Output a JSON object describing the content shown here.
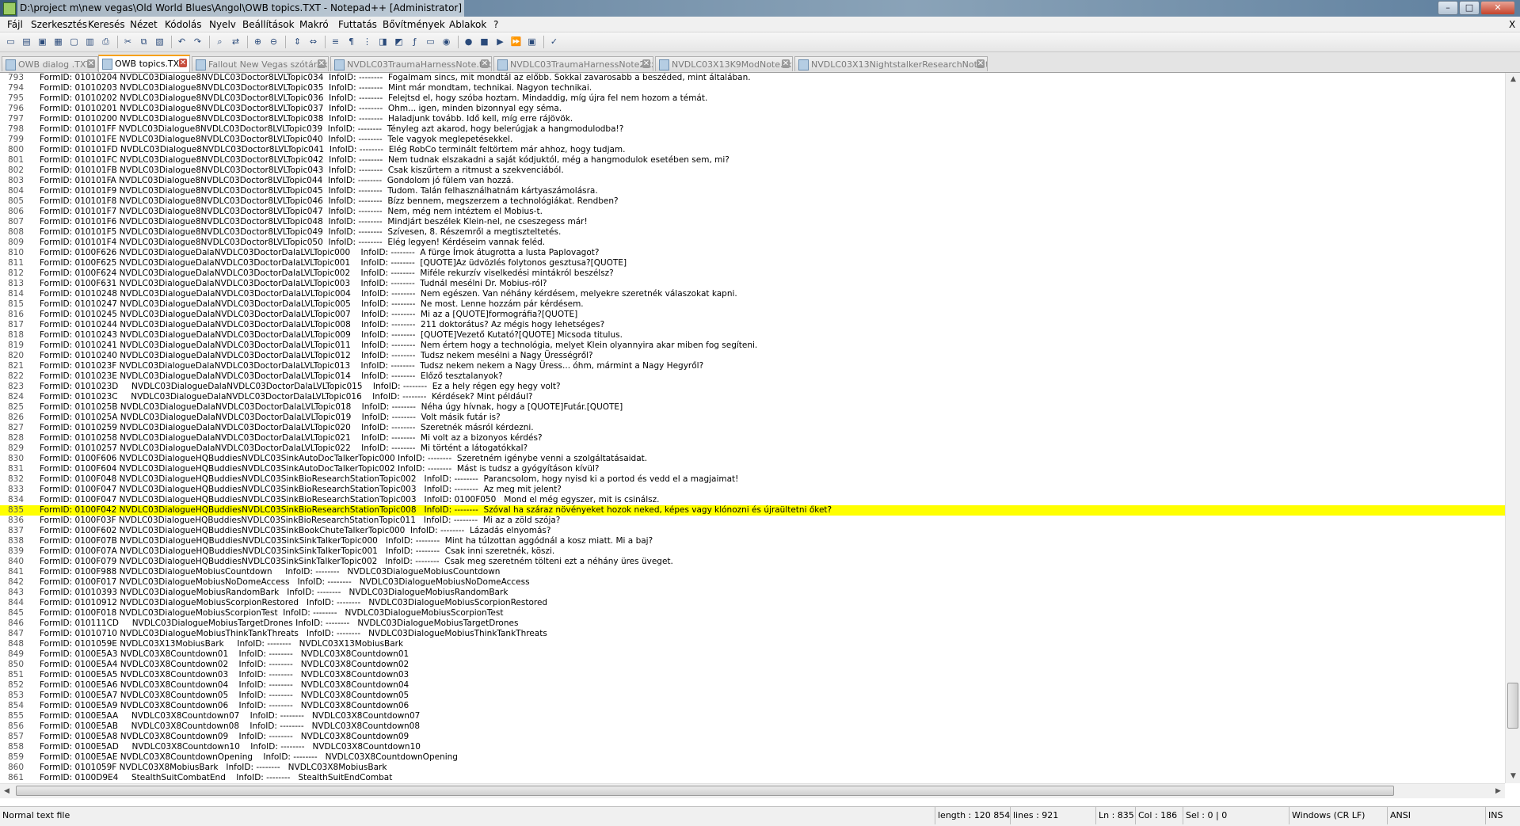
{
  "window": {
    "title": "D:\\project m\\new vegas\\Old World Blues\\Angol\\OWB topics.TXT - Notepad++ [Administrator]",
    "controls": {
      "minimize": "–",
      "maximize": "□",
      "close": "✕"
    }
  },
  "menu": [
    "Fájl",
    "Szerkesztés",
    "Keresés",
    "Nézet",
    "Kódolás",
    "Nyelv",
    "Beállítások",
    "Makró",
    "Futtatás",
    "Bővítmények",
    "Ablakok",
    "?"
  ],
  "menu_right_close": "X",
  "tabs": [
    {
      "label": "OWB dialog .TXT",
      "active": false
    },
    {
      "label": "OWB topics.TXT",
      "active": true
    },
    {
      "label": "Fallout New Vegas szótár.txt",
      "active": false
    },
    {
      "label": "NVDLC03TraumaHarnessNote.txt",
      "active": false
    },
    {
      "label": "NVDLC03TraumaHarnessNote2.txt",
      "active": false
    },
    {
      "label": "NVDLC03X13K9ModNote.txt",
      "active": false
    },
    {
      "label": "NVDLC03X13NightstalkerResearchNote.txt",
      "active": false
    }
  ],
  "editor": {
    "highlight_line": "835",
    "lines": [
      {
        "n": "793",
        "t": "FormID: 01010204 NVDLC03Dialogue8NVDLC03Doctor8LVLTopic034  InfoID: --------  Fogalmam sincs, mit mondtál az előbb. Sokkal zavarosabb a beszéded, mint általában."
      },
      {
        "n": "794",
        "t": "FormID: 01010203 NVDLC03Dialogue8NVDLC03Doctor8LVLTopic035  InfoID: --------  Mint már mondtam, technikai. Nagyon technikai."
      },
      {
        "n": "795",
        "t": "FormID: 01010202 NVDLC03Dialogue8NVDLC03Doctor8LVLTopic036  InfoID: --------  Felejtsd el, hogy szóba hoztam. Mindaddig, míg újra fel nem hozom a témát."
      },
      {
        "n": "796",
        "t": "FormID: 01010201 NVDLC03Dialogue8NVDLC03Doctor8LVLTopic037  InfoID: --------  Ohm... igen, minden bizonnyal egy séma."
      },
      {
        "n": "797",
        "t": "FormID: 01010200 NVDLC03Dialogue8NVDLC03Doctor8LVLTopic038  InfoID: --------  Haladjunk tovább. Idő kell, míg erre rájövök."
      },
      {
        "n": "798",
        "t": "FormID: 010101FF NVDLC03Dialogue8NVDLC03Doctor8LVLTopic039  InfoID: --------  Tényleg azt akarod, hogy belerúgjak a hangmodulodba!?"
      },
      {
        "n": "799",
        "t": "FormID: 010101FE NVDLC03Dialogue8NVDLC03Doctor8LVLTopic040  InfoID: --------  Tele vagyok meglepetésekkel."
      },
      {
        "n": "800",
        "t": "FormID: 010101FD NVDLC03Dialogue8NVDLC03Doctor8LVLTopic041  InfoID: --------  Elég RobCo terminált feltörtem már ahhoz, hogy tudjam."
      },
      {
        "n": "801",
        "t": "FormID: 010101FC NVDLC03Dialogue8NVDLC03Doctor8LVLTopic042  InfoID: --------  Nem tudnak elszakadni a saját kódjuktól, még a hangmodulok esetében sem, mi?"
      },
      {
        "n": "802",
        "t": "FormID: 010101FB NVDLC03Dialogue8NVDLC03Doctor8LVLTopic043  InfoID: --------  Csak kiszűrtem a ritmust a szekvenciából."
      },
      {
        "n": "803",
        "t": "FormID: 010101FA NVDLC03Dialogue8NVDLC03Doctor8LVLTopic044  InfoID: --------  Gondolom jó fülem van hozzá."
      },
      {
        "n": "804",
        "t": "FormID: 010101F9 NVDLC03Dialogue8NVDLC03Doctor8LVLTopic045  InfoID: --------  Tudom. Talán felhasználhatnám kártyaszámolásra."
      },
      {
        "n": "805",
        "t": "FormID: 010101F8 NVDLC03Dialogue8NVDLC03Doctor8LVLTopic046  InfoID: --------  Bízz bennem, megszerzem a technológiákat. Rendben?"
      },
      {
        "n": "806",
        "t": "FormID: 010101F7 NVDLC03Dialogue8NVDLC03Doctor8LVLTopic047  InfoID: --------  Nem, még nem intéztem el Mobius-t."
      },
      {
        "n": "807",
        "t": "FormID: 010101F6 NVDLC03Dialogue8NVDLC03Doctor8LVLTopic048  InfoID: --------  Mindjárt beszélek Klein-nel, ne cseszegess már!"
      },
      {
        "n": "808",
        "t": "FormID: 010101F5 NVDLC03Dialogue8NVDLC03Doctor8LVLTopic049  InfoID: --------  Szívesen, 8. Részemről a megtiszteltetés."
      },
      {
        "n": "809",
        "t": "FormID: 010101F4 NVDLC03Dialogue8NVDLC03Doctor8LVLTopic050  InfoID: --------  Elég legyen! Kérdéseim vannak feléd."
      },
      {
        "n": "810",
        "t": "FormID: 0100F626 NVDLC03DialogueDalaNVDLC03DoctorDalaLVLTopic000    InfoID: --------  A fürge Írnok átugrotta a lusta Paplovagot?"
      },
      {
        "n": "811",
        "t": "FormID: 0100F625 NVDLC03DialogueDalaNVDLC03DoctorDalaLVLTopic001    InfoID: --------  [QUOTE]Az üdvözlés folytonos gesztusa?[QUOTE]"
      },
      {
        "n": "812",
        "t": "FormID: 0100F624 NVDLC03DialogueDalaNVDLC03DoctorDalaLVLTopic002    InfoID: --------  Miféle rekurzív viselkedési mintákról beszélsz?"
      },
      {
        "n": "813",
        "t": "FormID: 0100F631 NVDLC03DialogueDalaNVDLC03DoctorDalaLVLTopic003    InfoID: --------  Tudnál mesélni Dr. Mobius-ról?"
      },
      {
        "n": "814",
        "t": "FormID: 01010248 NVDLC03DialogueDalaNVDLC03DoctorDalaLVLTopic004    InfoID: --------  Nem egészen. Van néhány kérdésem, melyekre szeretnék válaszokat kapni."
      },
      {
        "n": "815",
        "t": "FormID: 01010247 NVDLC03DialogueDalaNVDLC03DoctorDalaLVLTopic005    InfoID: --------  Ne most. Lenne hozzám pár kérdésem."
      },
      {
        "n": "816",
        "t": "FormID: 01010245 NVDLC03DialogueDalaNVDLC03DoctorDalaLVLTopic007    InfoID: --------  Mi az a [QUOTE]formográfia?[QUOTE]"
      },
      {
        "n": "817",
        "t": "FormID: 01010244 NVDLC03DialogueDalaNVDLC03DoctorDalaLVLTopic008    InfoID: --------  211 doktorátus? Az mégis hogy lehetséges?"
      },
      {
        "n": "818",
        "t": "FormID: 01010243 NVDLC03DialogueDalaNVDLC03DoctorDalaLVLTopic009    InfoID: --------  [QUOTE]Vezető Kutató?[QUOTE] Micsoda titulus."
      },
      {
        "n": "819",
        "t": "FormID: 01010241 NVDLC03DialogueDalaNVDLC03DoctorDalaLVLTopic011    InfoID: --------  Nem értem hogy a technológia, melyet Klein olyannyira akar miben fog segíteni."
      },
      {
        "n": "820",
        "t": "FormID: 01010240 NVDLC03DialogueDalaNVDLC03DoctorDalaLVLTopic012    InfoID: --------  Tudsz nekem mesélni a Nagy Ürességről?"
      },
      {
        "n": "821",
        "t": "FormID: 0101023F NVDLC03DialogueDalaNVDLC03DoctorDalaLVLTopic013    InfoID: --------  Tudsz nekem nekem a Nagy Üress... óhm, mármint a Nagy Hegyről?"
      },
      {
        "n": "822",
        "t": "FormID: 0101023E NVDLC03DialogueDalaNVDLC03DoctorDalaLVLTopic014    InfoID: --------  Előző tesztalanyok?"
      },
      {
        "n": "823",
        "t": "FormID: 0101023D     NVDLC03DialogueDalaNVDLC03DoctorDalaLVLTopic015    InfoID: --------  Ez a hely régen egy hegy volt?"
      },
      {
        "n": "824",
        "t": "FormID: 0101023C     NVDLC03DialogueDalaNVDLC03DoctorDalaLVLTopic016    InfoID: --------  Kérdések? Mint például?"
      },
      {
        "n": "825",
        "t": "FormID: 0101025B NVDLC03DialogueDalaNVDLC03DoctorDalaLVLTopic018    InfoID: --------  Néha úgy hívnak, hogy a [QUOTE]Futár.[QUOTE]"
      },
      {
        "n": "826",
        "t": "FormID: 0101025A NVDLC03DialogueDalaNVDLC03DoctorDalaLVLTopic019    InfoID: --------  Volt másik futár is?"
      },
      {
        "n": "827",
        "t": "FormID: 01010259 NVDLC03DialogueDalaNVDLC03DoctorDalaLVLTopic020    InfoID: --------  Szeretnék másról kérdezni."
      },
      {
        "n": "828",
        "t": "FormID: 01010258 NVDLC03DialogueDalaNVDLC03DoctorDalaLVLTopic021    InfoID: --------  Mi volt az a bizonyos kérdés?"
      },
      {
        "n": "829",
        "t": "FormID: 01010257 NVDLC03DialogueDalaNVDLC03DoctorDalaLVLTopic022    InfoID: --------  Mi történt a látogatókkal?"
      },
      {
        "n": "830",
        "t": "FormID: 0100F606 NVDLC03DialogueHQBuddiesNVDLC03SinkAutoDocTalkerTopic000 InfoID: --------  Szeretném igénybe venni a szolgáltatásaidat."
      },
      {
        "n": "831",
        "t": "FormID: 0100F604 NVDLC03DialogueHQBuddiesNVDLC03SinkAutoDocTalkerTopic002 InfoID: --------  Mást is tudsz a gyógyításon kívül?"
      },
      {
        "n": "832",
        "t": "FormID: 0100F048 NVDLC03DialogueHQBuddiesNVDLC03SinkBioResearchStationTopic002   InfoID: --------  Parancsolom, hogy nyisd ki a portod és vedd el a magjaimat!"
      },
      {
        "n": "833",
        "t": "FormID: 0100F047 NVDLC03DialogueHQBuddiesNVDLC03SinkBioResearchStationTopic003   InfoID: --------  Az meg mit jelent?"
      },
      {
        "n": "834",
        "t": "FormID: 0100F047 NVDLC03DialogueHQBuddiesNVDLC03SinkBioResearchStationTopic003   InfoID: 0100F050   Mond el még egyszer, mit is csinálsz."
      },
      {
        "n": "835",
        "t": "FormID: 0100F042 NVDLC03DialogueHQBuddiesNVDLC03SinkBioResearchStationTopic008   InfoID: --------  Szóval ha száraz növényeket hozok neked, képes vagy klónozni és újraültetni őket?"
      },
      {
        "n": "836",
        "t": "FormID: 0100F03F NVDLC03DialogueHQBuddiesNVDLC03SinkBioResearchStationTopic011   InfoID: --------  Mi az a zöld szója?"
      },
      {
        "n": "837",
        "t": "FormID: 0100F602 NVDLC03DialogueHQBuddiesNVDLC03SinkBookChuteTalkerTopic000  InfoID: --------  Lázadás elnyomás?"
      },
      {
        "n": "838",
        "t": "FormID: 0100F07B NVDLC03DialogueHQBuddiesNVDLC03SinkSinkTalkerTopic000   InfoID: --------  Mint ha túlzottan aggódnál a kosz miatt. Mi a baj?"
      },
      {
        "n": "839",
        "t": "FormID: 0100F07A NVDLC03DialogueHQBuddiesNVDLC03SinkSinkTalkerTopic001   InfoID: --------  Csak inni szeretnék, köszi."
      },
      {
        "n": "840",
        "t": "FormID: 0100F079 NVDLC03DialogueHQBuddiesNVDLC03SinkSinkTalkerTopic002   InfoID: --------  Csak meg szeretném tölteni ezt a néhány üres üveget."
      },
      {
        "n": "841",
        "t": "FormID: 0100F988 NVDLC03DialogueMobiusCountdown     InfoID: --------   NVDLC03DialogueMobiusCountdown"
      },
      {
        "n": "842",
        "t": "FormID: 0100F017 NVDLC03DialogueMobiusNoDomeAccess   InfoID: --------   NVDLC03DialogueMobiusNoDomeAccess"
      },
      {
        "n": "843",
        "t": "FormID: 01010393 NVDLC03DialogueMobiusRandomBark   InfoID: --------   NVDLC03DialogueMobiusRandomBark"
      },
      {
        "n": "844",
        "t": "FormID: 01010912 NVDLC03DialogueMobiusScorpionRestored   InfoID: --------   NVDLC03DialogueMobiusScorpionRestored"
      },
      {
        "n": "845",
        "t": "FormID: 0100F018 NVDLC03DialogueMobiusScorpionTest  InfoID: --------   NVDLC03DialogueMobiusScorpionTest"
      },
      {
        "n": "846",
        "t": "FormID: 010111CD     NVDLC03DialogueMobiusTargetDrones InfoID: --------   NVDLC03DialogueMobiusTargetDrones"
      },
      {
        "n": "847",
        "t": "FormID: 01010710 NVDLC03DialogueMobiusThinkTankThreats   InfoID: --------   NVDLC03DialogueMobiusThinkTankThreats"
      },
      {
        "n": "848",
        "t": "FormID: 0101059E NVDLC03X13MobiusBark     InfoID: --------   NVDLC03X13MobiusBark"
      },
      {
        "n": "849",
        "t": "FormID: 0100E5A3 NVDLC03X8Countdown01    InfoID: --------   NVDLC03X8Countdown01"
      },
      {
        "n": "850",
        "t": "FormID: 0100E5A4 NVDLC03X8Countdown02    InfoID: --------   NVDLC03X8Countdown02"
      },
      {
        "n": "851",
        "t": "FormID: 0100E5A5 NVDLC03X8Countdown03    InfoID: --------   NVDLC03X8Countdown03"
      },
      {
        "n": "852",
        "t": "FormID: 0100E5A6 NVDLC03X8Countdown04    InfoID: --------   NVDLC03X8Countdown04"
      },
      {
        "n": "853",
        "t": "FormID: 0100E5A7 NVDLC03X8Countdown05    InfoID: --------   NVDLC03X8Countdown05"
      },
      {
        "n": "854",
        "t": "FormID: 0100E5A9 NVDLC03X8Countdown06    InfoID: --------   NVDLC03X8Countdown06"
      },
      {
        "n": "855",
        "t": "FormID: 0100E5AA     NVDLC03X8Countdown07    InfoID: --------   NVDLC03X8Countdown07"
      },
      {
        "n": "856",
        "t": "FormID: 0100E5AB     NVDLC03X8Countdown08    InfoID: --------   NVDLC03X8Countdown08"
      },
      {
        "n": "857",
        "t": "FormID: 0100E5A8 NVDLC03X8Countdown09    InfoID: --------   NVDLC03X8Countdown09"
      },
      {
        "n": "858",
        "t": "FormID: 0100E5AD     NVDLC03X8Countdown10    InfoID: --------   NVDLC03X8Countdown10"
      },
      {
        "n": "859",
        "t": "FormID: 0100E5AE NVDLC03X8CountdownOpening    InfoID: --------   NVDLC03X8CountdownOpening"
      },
      {
        "n": "860",
        "t": "FormID: 0101059F NVDLC03X8MobiusBark   InfoID: --------   NVDLC03X8MobiusBark"
      },
      {
        "n": "861",
        "t": "FormID: 0100D9E4     StealthSuitCombatEnd    InfoID: --------   StealthSuitEndCombat"
      }
    ]
  },
  "statusbar": {
    "file_type": "Normal text file",
    "length": "length : 120 854",
    "lines": "lines : 921",
    "ln": "Ln : 835",
    "col": "Col : 186",
    "sel": "Sel : 0 | 0",
    "eol": "Windows (CR LF)",
    "encoding": "ANSI",
    "mode": "INS"
  },
  "colors": {
    "highlight": "#ffff00",
    "active_tab_accent": "#f7a11a"
  }
}
